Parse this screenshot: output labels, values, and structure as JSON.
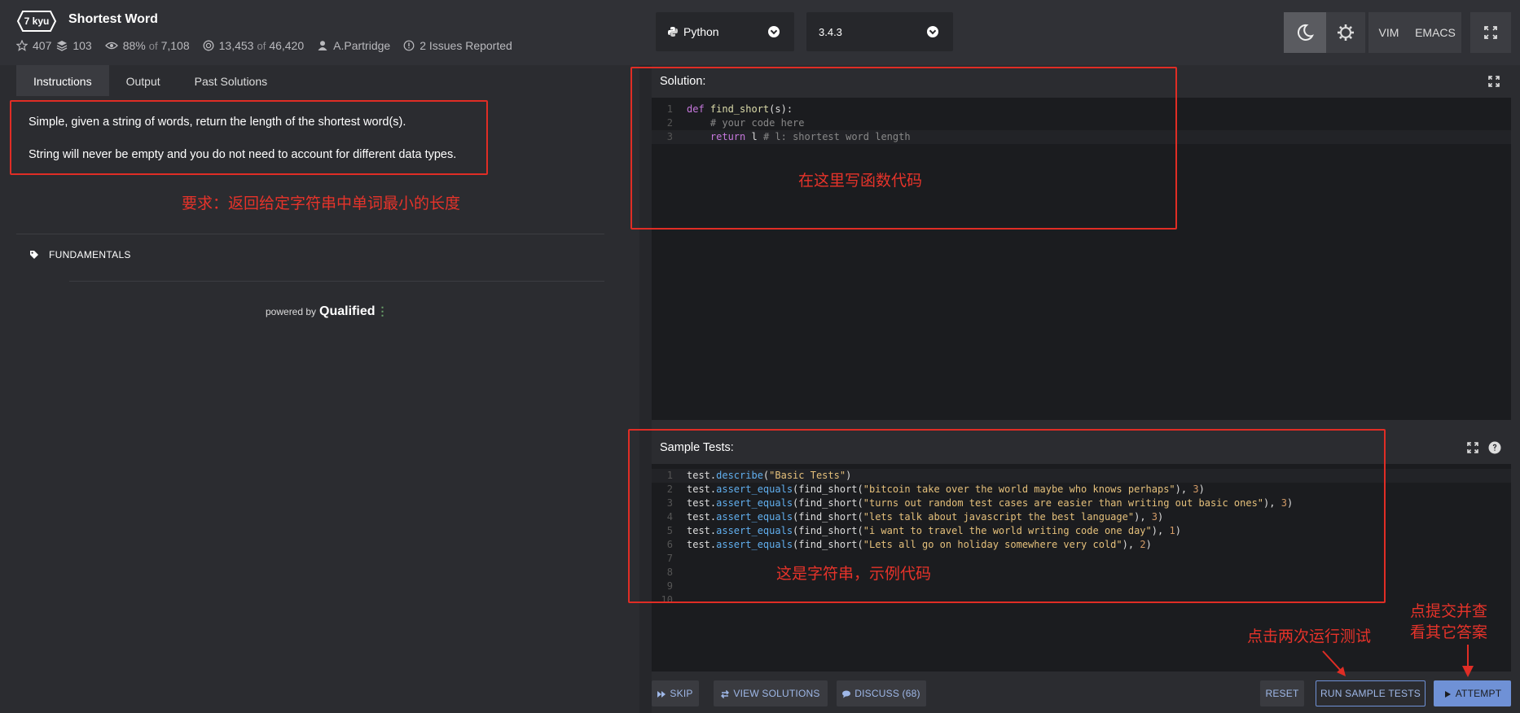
{
  "header": {
    "rank": "7 kyu",
    "title": "Shortest Word",
    "stats": {
      "stars": "407",
      "collections": "103",
      "satisfaction": "88%",
      "satisfaction_of": "of",
      "satisfaction_total": "7,108",
      "completed": "13,453",
      "completed_of": "of",
      "completed_total": "46,420",
      "author": "A.Partridge",
      "issues": "2 Issues Reported"
    },
    "language": "Python",
    "version": "3.4.3",
    "modes": [
      "VIM",
      "EMACS"
    ]
  },
  "tabs": [
    "Instructions",
    "Output",
    "Past Solutions"
  ],
  "instructions": {
    "line1": "Simple, given a string of words, return the length of the shortest word(s).",
    "line2": "String will never be empty and you do not need to account for different data types."
  },
  "tag": "FUNDAMENTALS",
  "powered": {
    "by": "powered by",
    "brand": "Qualified"
  },
  "solution": {
    "title": "Solution:",
    "lines": [
      {
        "n": "1",
        "parts": [
          [
            "kw",
            "def "
          ],
          [
            "fn",
            "find_short"
          ],
          [
            "",
            "(s):"
          ]
        ]
      },
      {
        "n": "2",
        "parts": [
          [
            "cm",
            "    # your code here"
          ]
        ]
      },
      {
        "n": "3",
        "parts": [
          [
            "",
            "    "
          ],
          [
            "kw",
            "return"
          ],
          [
            "",
            " l "
          ],
          [
            "cm",
            "# l: shortest word length"
          ]
        ]
      }
    ]
  },
  "tests": {
    "title": "Sample Tests:",
    "lines": [
      {
        "n": "1",
        "parts": [
          [
            "",
            "test."
          ],
          [
            "meth",
            "describe"
          ],
          [
            "",
            "("
          ],
          [
            "str",
            "\"Basic Tests\""
          ],
          [
            "",
            ")"
          ]
        ]
      },
      {
        "n": "2",
        "parts": [
          [
            "",
            "test."
          ],
          [
            "meth",
            "assert_equals"
          ],
          [
            "",
            "(find_short("
          ],
          [
            "str",
            "\"bitcoin take over the world maybe who knows perhaps\""
          ],
          [
            "",
            "), "
          ],
          [
            "num",
            "3"
          ],
          [
            "",
            ")"
          ]
        ]
      },
      {
        "n": "3",
        "parts": [
          [
            "",
            "test."
          ],
          [
            "meth",
            "assert_equals"
          ],
          [
            "",
            "(find_short("
          ],
          [
            "str",
            "\"turns out random test cases are easier than writing out basic ones\""
          ],
          [
            "",
            "), "
          ],
          [
            "num",
            "3"
          ],
          [
            "",
            ")"
          ]
        ]
      },
      {
        "n": "4",
        "parts": [
          [
            "",
            "test."
          ],
          [
            "meth",
            "assert_equals"
          ],
          [
            "",
            "(find_short("
          ],
          [
            "str",
            "\"lets talk about javascript the best language\""
          ],
          [
            "",
            "), "
          ],
          [
            "num",
            "3"
          ],
          [
            "",
            ")"
          ]
        ]
      },
      {
        "n": "5",
        "parts": [
          [
            "",
            "test."
          ],
          [
            "meth",
            "assert_equals"
          ],
          [
            "",
            "(find_short("
          ],
          [
            "str",
            "\"i want to travel the world writing code one day\""
          ],
          [
            "",
            "), "
          ],
          [
            "num",
            "1"
          ],
          [
            "",
            ")"
          ]
        ]
      },
      {
        "n": "6",
        "parts": [
          [
            "",
            "test."
          ],
          [
            "meth",
            "assert_equals"
          ],
          [
            "",
            "(find_short("
          ],
          [
            "str",
            "\"Lets all go on holiday somewhere very cold\""
          ],
          [
            "",
            "), "
          ],
          [
            "num",
            "2"
          ],
          [
            "",
            ")"
          ]
        ]
      },
      {
        "n": "7",
        "parts": []
      },
      {
        "n": "8",
        "parts": []
      },
      {
        "n": "9",
        "parts": []
      },
      {
        "n": "10",
        "parts": []
      }
    ]
  },
  "footer": {
    "skip": "SKIP",
    "view_solutions": "VIEW SOLUTIONS",
    "discuss": "DISCUSS (68)",
    "reset": "RESET",
    "run_tests": "RUN SAMPLE TESTS",
    "attempt": "ATTEMPT"
  },
  "annotations": {
    "requirement": "要求：返回给定字符串中单词最小的长度",
    "write_here": "在这里写函数代码",
    "sample_code": "这是字符串，示例代码",
    "run_twice": "点击两次运行测试",
    "submit_line1": "点提交并查",
    "submit_line2": "看其它答案"
  },
  "colors": {
    "accent": "#6f91d6",
    "annotation": "#e02d25",
    "editor_bg": "#1b1c1f"
  }
}
